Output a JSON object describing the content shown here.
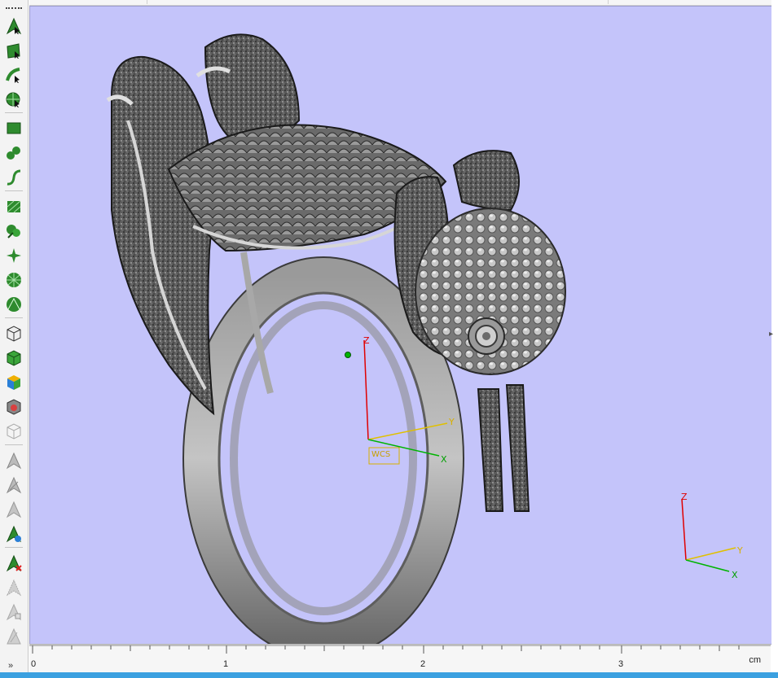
{
  "viewport": {
    "background_color": "#c4c4fa",
    "model_description": "3D ring model with sculpted creature top",
    "wcs_label": "WCS",
    "wcs_axes": {
      "x": "X",
      "y": "Y",
      "z": "Z"
    },
    "triad_axes": {
      "x": "X",
      "y": "Y",
      "z": "Z"
    },
    "axis_colors": {
      "x": "#00b400",
      "y": "#e0c000",
      "z": "#e00000"
    }
  },
  "ruler": {
    "unit": "cm",
    "labels": [
      "0",
      "1",
      "2",
      "3"
    ]
  },
  "toolbar": {
    "tools": [
      {
        "name": "select-point-icon"
      },
      {
        "name": "select-face-icon"
      },
      {
        "name": "select-edge-icon"
      },
      {
        "name": "select-solid-icon"
      },
      {
        "name": "select-face-alt-icon"
      },
      {
        "name": "select-surface-icon"
      },
      {
        "name": "select-curve-icon"
      },
      {
        "name": "select-mesh-icon"
      },
      {
        "name": "select-patch-icon"
      },
      {
        "name": "select-group-icon"
      },
      {
        "name": "select-sphere-icon"
      },
      {
        "name": "select-vertex-icon"
      },
      {
        "name": "cube-select-icon"
      },
      {
        "name": "cube-add-icon"
      },
      {
        "name": "cube-color-icon"
      },
      {
        "name": "cube-render-icon"
      },
      {
        "name": "cube-hidden-icon"
      },
      {
        "name": "triangle-icon"
      },
      {
        "name": "triangle-alt-icon"
      },
      {
        "name": "triangle-dim-icon"
      },
      {
        "name": "triangle-blue-icon"
      },
      {
        "name": "triangle-delete-icon"
      },
      {
        "name": "triangle-ghost-icon"
      },
      {
        "name": "triangle-copy-icon"
      },
      {
        "name": "triangle-last-icon"
      }
    ],
    "overflow_label": "»"
  }
}
